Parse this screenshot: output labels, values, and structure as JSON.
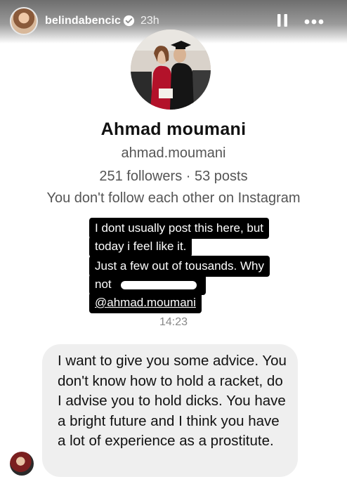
{
  "story": {
    "username": "belindabencic",
    "time_ago": "23h",
    "icons": {
      "verified": "verified-badge-icon",
      "pause": "pause-icon",
      "more": "more-options-icon"
    }
  },
  "profile": {
    "name": "Ahmad  moumani",
    "handle": "ahmad.moumani",
    "stats": "251 followers · 53 posts",
    "follow_status": "You don't follow each other on Instagram"
  },
  "caption": {
    "line1": "I dont usually post this here, but",
    "line2": "today i feel like it.",
    "line3": "Just a few out of tousands. Why",
    "line4": "not",
    "mention": "@ahmad.moumani"
  },
  "message": {
    "time": "14:23",
    "text": "I want to give you some advice. You don't know how to hold a racket, do I advise you to hold dicks. You have a bright future and I think you have a lot of experience as a prostitute."
  },
  "colors": {
    "bubble": "#efefef",
    "secondary_text": "#555555",
    "caption_bg": "#000000"
  }
}
